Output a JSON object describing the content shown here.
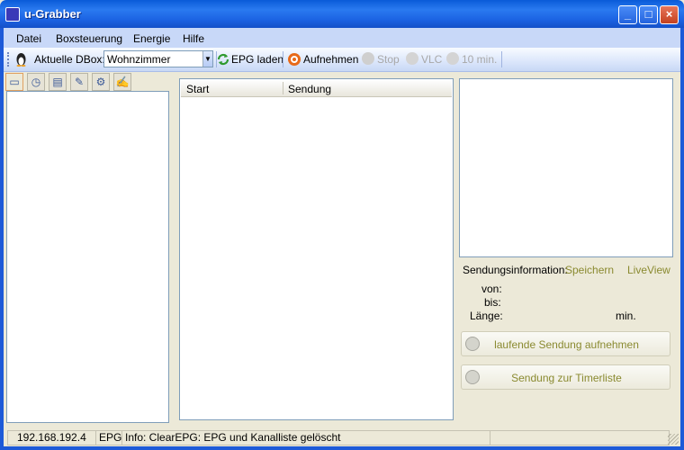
{
  "window": {
    "title": "u-Grabber"
  },
  "titlebar_buttons": {
    "minimize": "_",
    "maximize": "□",
    "close": "×"
  },
  "menu": [
    "Datei",
    "Boxsteuerung",
    "Energie",
    "Hilfe"
  ],
  "toolbar": {
    "dbox_label": "Aktuelle DBox:",
    "dbox_value": "Wohnzimmer",
    "epg_label": "EPG laden",
    "record_label": "Aufnehmen",
    "stop_label": "Stop",
    "vlc_label": "VLC",
    "timer_label": "10 min."
  },
  "left_tabs": [
    "tv-icon",
    "clock-icon",
    "film-icon",
    "feather-icon",
    "gear-icon",
    "edit-icon"
  ],
  "list": {
    "columns": [
      "Start",
      "Sendung"
    ]
  },
  "info": {
    "label": "Sendungsinformation:",
    "save_link": "Speichern",
    "liveview_link": "LiveView",
    "von_label": "von:",
    "bis_label": "bis:",
    "laenge_label": "Länge:",
    "min_label": "min."
  },
  "buttons": {
    "record_running": "laufende Sendung aufnehmen",
    "add_timer": "Sendung zur Timerliste"
  },
  "status": {
    "ip": "192.168.192.4",
    "mode": "EPG",
    "message": "Info: ClearEPG: EPG und Kanalliste gelöscht"
  },
  "colors": {
    "title_blue": "#1c63e3",
    "link_olive": "#8a8a30",
    "panel_bg": "#ece9d8"
  }
}
